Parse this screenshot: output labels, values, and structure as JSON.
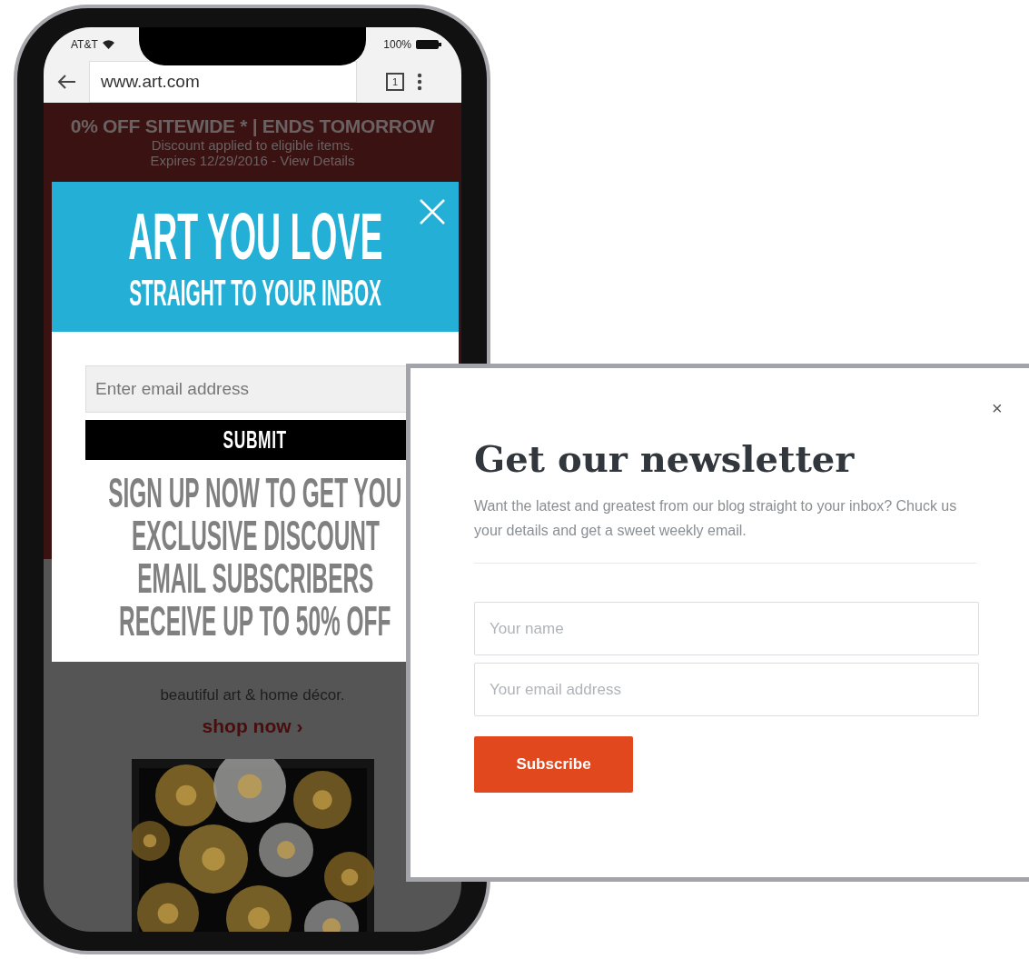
{
  "phone": {
    "status_bar": {
      "carrier": "AT&T",
      "battery": "100%"
    },
    "browser": {
      "url": "www.art.com",
      "tab_count": "1"
    },
    "banner": {
      "headline": "0% OFF SITEWIDE * | ENDS TOMORROW",
      "lines": [
        "Discount applied to eligible items.",
        "Expires 12/29/2016 - View Details"
      ]
    },
    "popup": {
      "title": "ART YOU LOVE",
      "subtitle": "STRAIGHT TO YOUR INBOX",
      "email_placeholder": "Enter email address",
      "submit": "SUBMIT",
      "promo_lines": [
        "SIGN UP NOW TO GET YOU",
        "EXCLUSIVE DISCOUNT",
        "EMAIL SUBSCRIBERS",
        "RECEIVE UP TO 50% OFF"
      ]
    },
    "page": {
      "tagline": "beautiful art & home décor.",
      "link": "shop now ›"
    }
  },
  "newsletter": {
    "close": "×",
    "title": "Get our newsletter",
    "description": "Want the latest and greatest from our blog straight to your inbox? Chuck us your details and get a sweet weekly email.",
    "fields": [
      {
        "placeholder": "Your name"
      },
      {
        "placeholder": "Your email address"
      }
    ],
    "button": "Subscribe"
  }
}
